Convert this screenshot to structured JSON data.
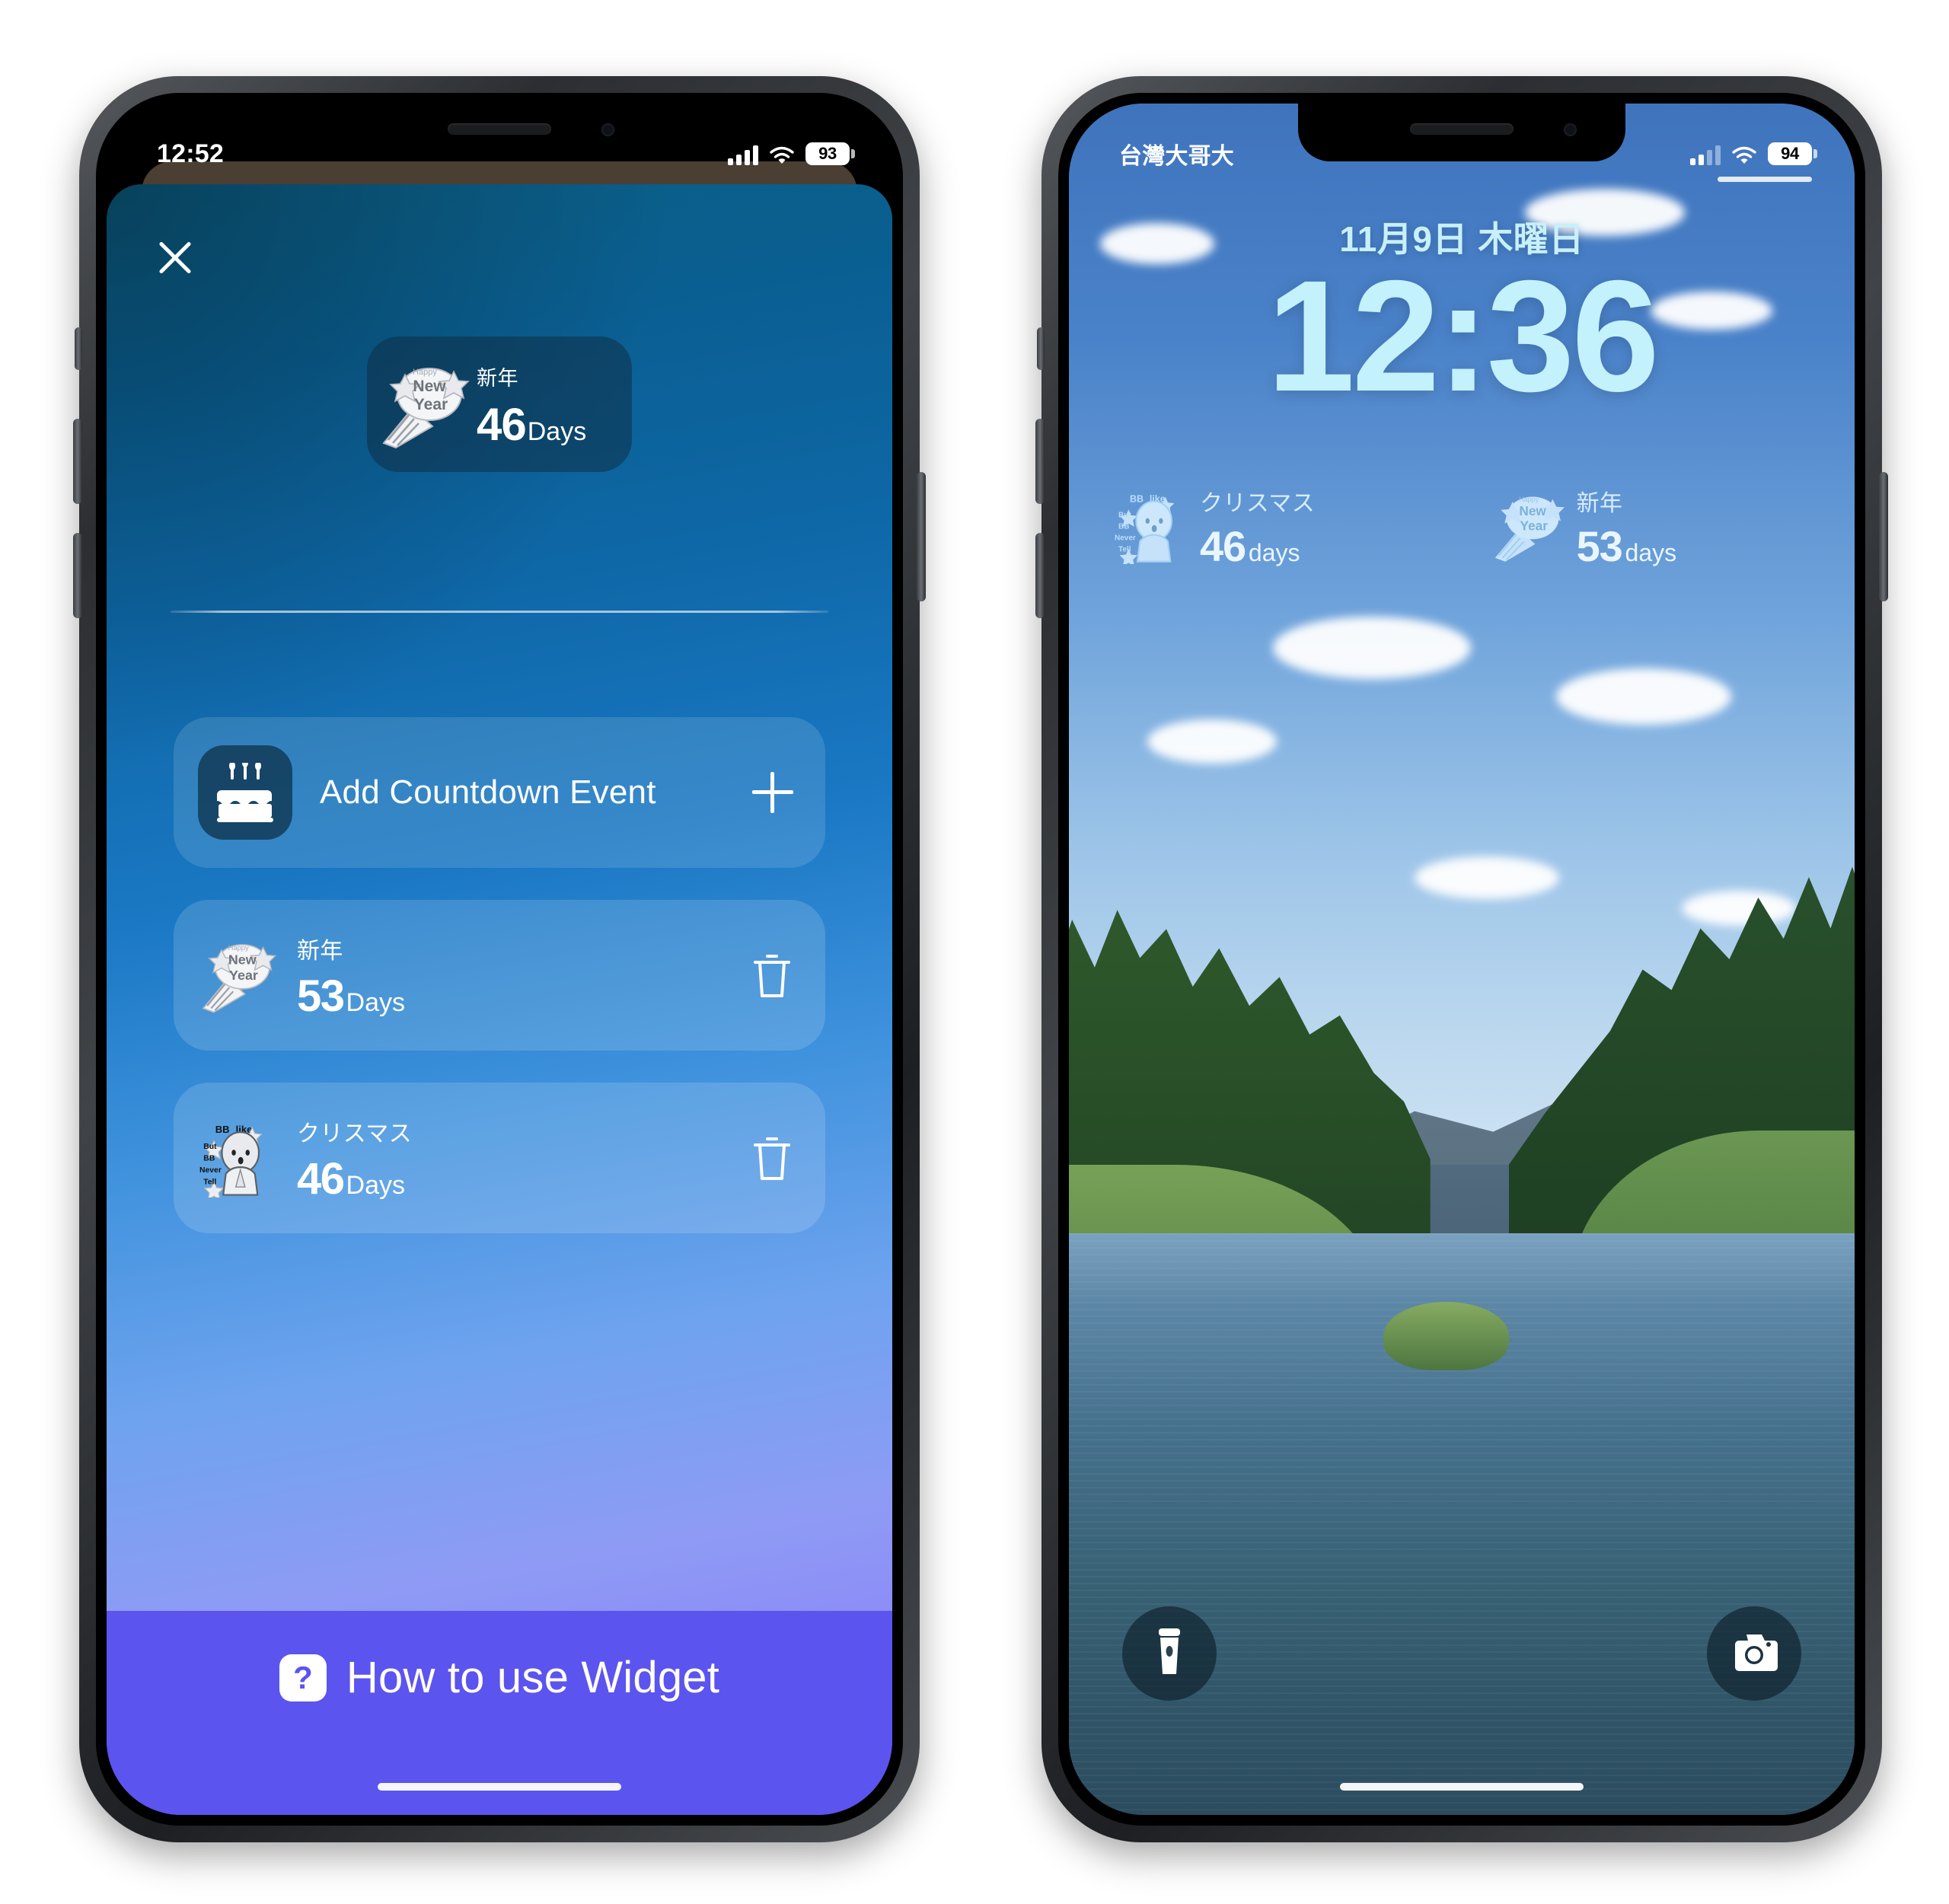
{
  "left_phone": {
    "status_bar": {
      "time": "12:52",
      "battery_percent": "93",
      "signal_icon": "cellular-signal-icon",
      "wifi_icon": "wifi-icon",
      "battery_icon": "battery-icon"
    },
    "sheet": {
      "close_icon": "close-icon",
      "preview_widget": {
        "title": "新年",
        "count": "46",
        "unit": "Days",
        "icon": "happy-new-year-sticker"
      },
      "add_row": {
        "label": "Add Countdown Event",
        "icon": "birthday-cake-icon",
        "action_icon": "plus-icon"
      },
      "events": [
        {
          "title": "新年",
          "count": "53",
          "unit": "Days",
          "icon": "happy-new-year-sticker",
          "delete_icon": "trash-icon"
        },
        {
          "title": "クリスマス",
          "count": "46",
          "unit": "Days",
          "icon": "bb-character-sticker",
          "delete_icon": "trash-icon"
        }
      ],
      "footer": {
        "label": "How to use Widget",
        "icon": "question-mark-icon",
        "background_color": "#5b54ee"
      }
    }
  },
  "right_phone": {
    "status_bar": {
      "carrier": "台灣大哥大",
      "battery_percent": "94",
      "signal_icon": "cellular-signal-icon",
      "wifi_icon": "wifi-icon",
      "battery_icon": "battery-icon"
    },
    "lock_screen": {
      "date": "11月9日 木曜日",
      "time": "12:36",
      "clock_color": "#c3f1fc",
      "widgets": [
        {
          "title": "クリスマス",
          "count": "46",
          "unit": "days",
          "icon": "bb-character-sticker"
        },
        {
          "title": "新年",
          "count": "53",
          "unit": "days",
          "icon": "happy-new-year-sticker"
        }
      ],
      "actions": [
        {
          "name": "flashlight",
          "icon": "flashlight-icon"
        },
        {
          "name": "camera",
          "icon": "camera-icon"
        }
      ],
      "wallpaper_description": "river-landscape-photo"
    }
  }
}
